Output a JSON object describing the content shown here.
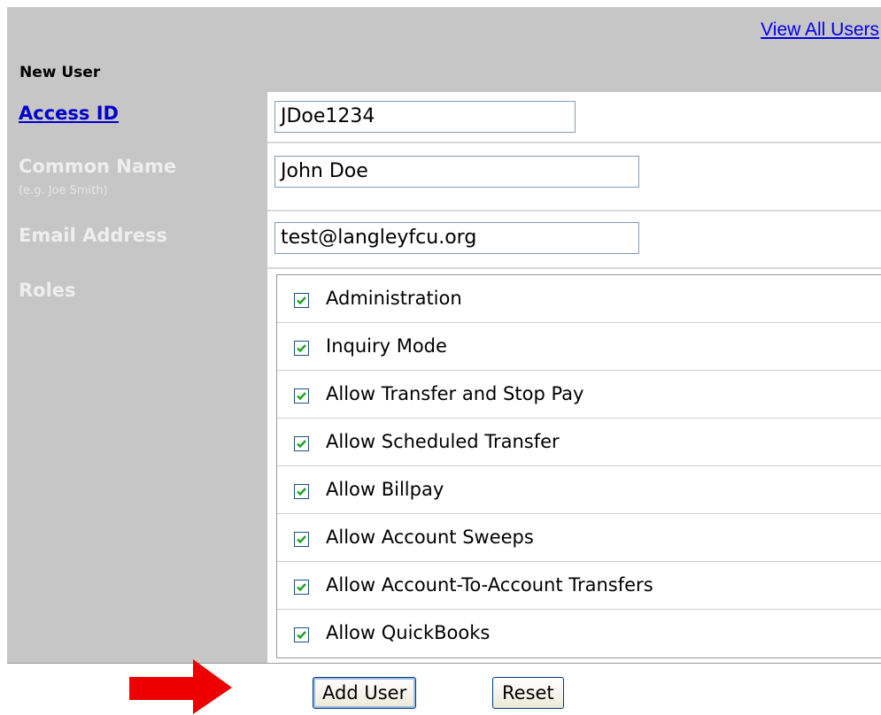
{
  "header": {
    "view_all_users": "View All Users",
    "section_title": "New User"
  },
  "form": {
    "access_id": {
      "label": "Access ID",
      "value": "JDoe1234"
    },
    "common_name": {
      "label": "Common Name",
      "hint": "(e.g. Joe Smith)",
      "value": "John Doe"
    },
    "email": {
      "label": "Email Address",
      "value": "test@langleyfcu.org"
    },
    "roles": {
      "label": "Roles",
      "items": [
        {
          "label": "Administration",
          "checked": true
        },
        {
          "label": "Inquiry Mode",
          "checked": true
        },
        {
          "label": "Allow Transfer and Stop Pay",
          "checked": true
        },
        {
          "label": "Allow Scheduled Transfer",
          "checked": true
        },
        {
          "label": "Allow Billpay",
          "checked": true
        },
        {
          "label": "Allow Account Sweeps",
          "checked": true
        },
        {
          "label": "Allow Account-To-Account Transfers",
          "checked": true
        },
        {
          "label": "Allow QuickBooks",
          "checked": true
        }
      ]
    }
  },
  "actions": {
    "add_user": "Add User",
    "reset": "Reset"
  },
  "colors": {
    "label_bg": "#c6c6c6",
    "link": "#0000ee",
    "arrow": "#ee0000",
    "checkmark": "#21a121"
  }
}
